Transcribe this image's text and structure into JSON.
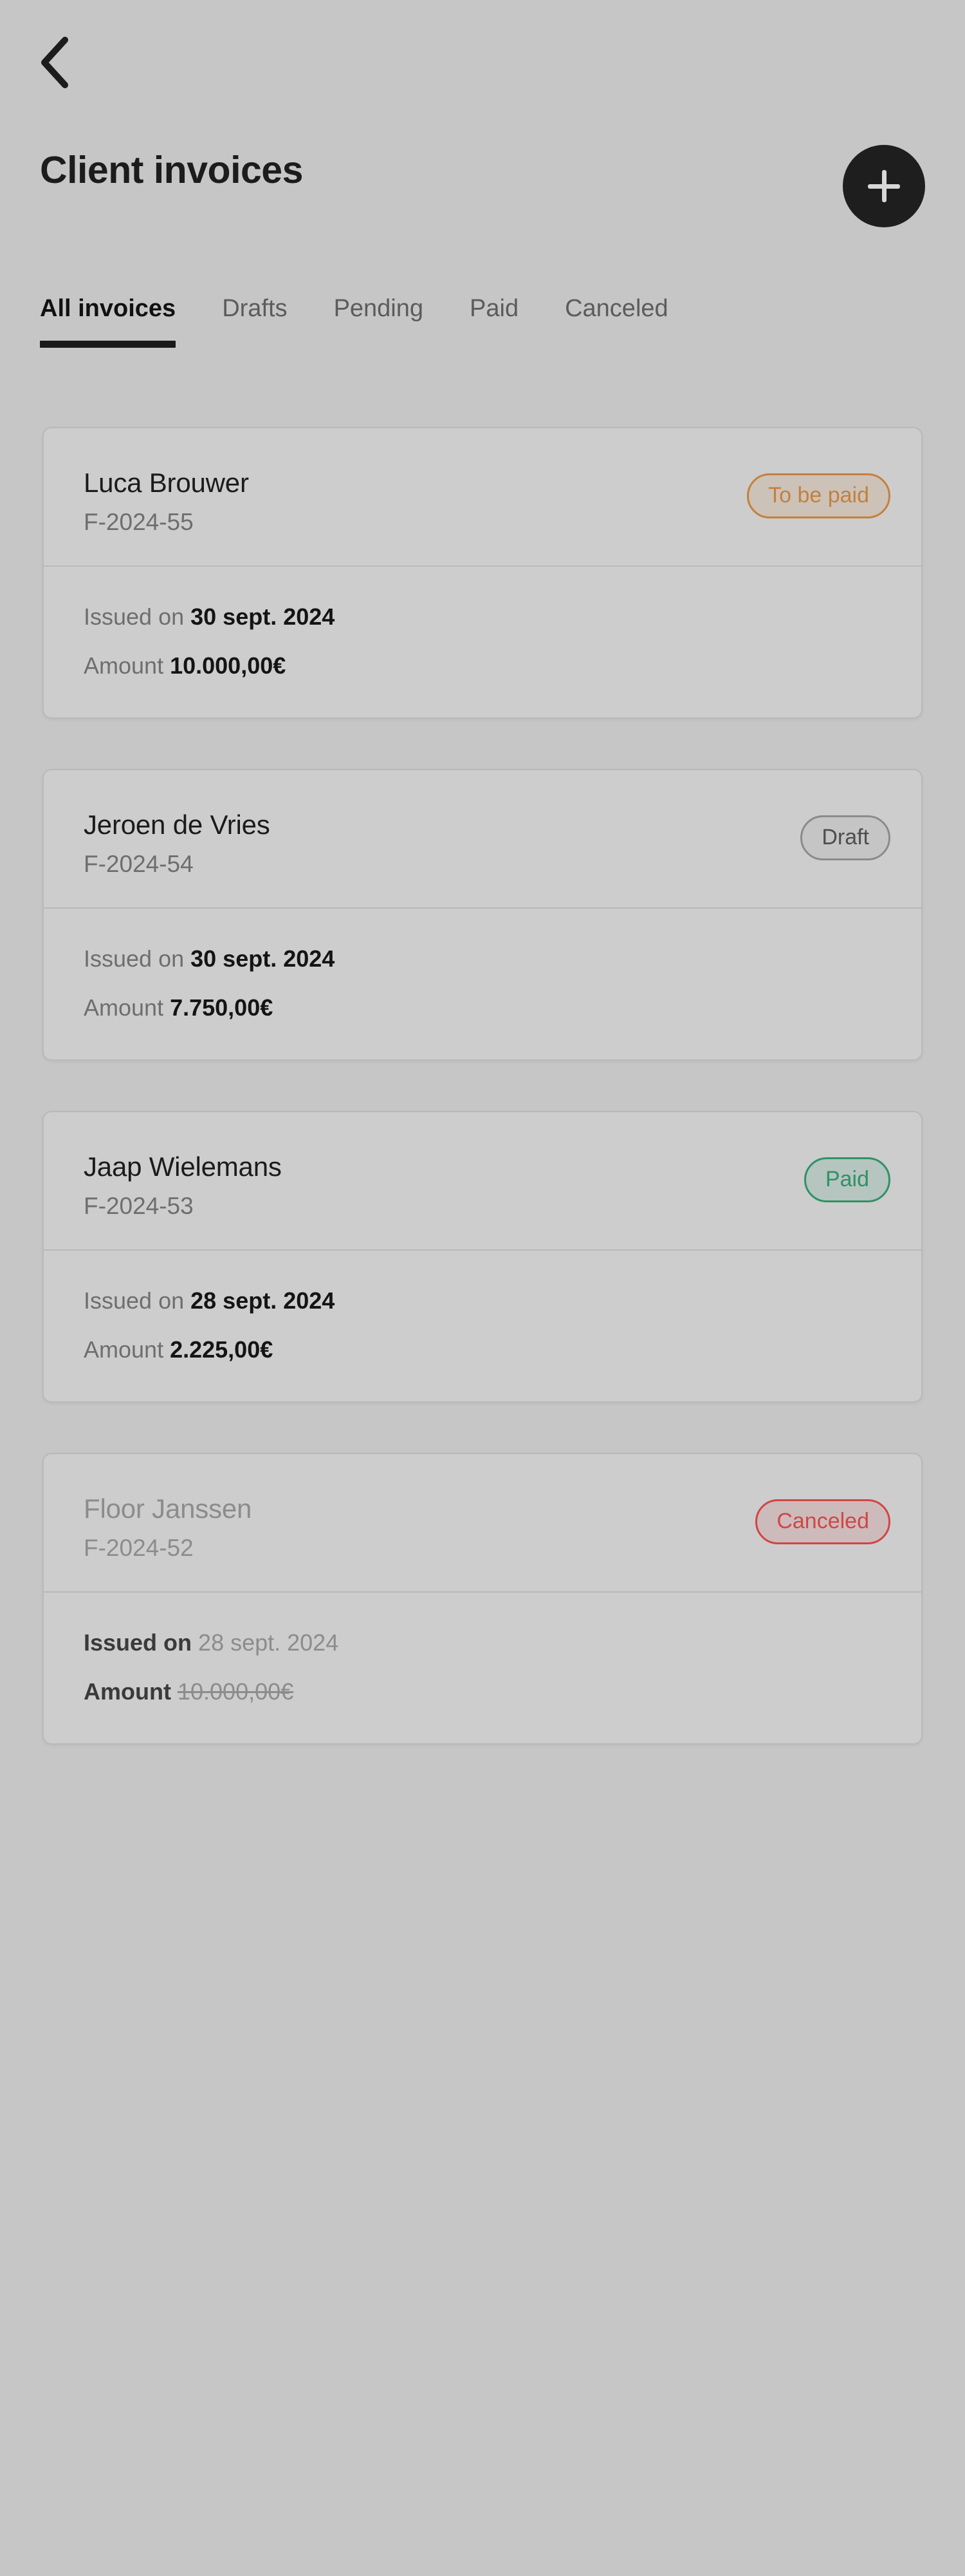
{
  "header": {
    "back_icon": "chevron-left-icon",
    "title": "Client invoices",
    "add_icon": "plus-icon",
    "add_label": "Add invoice"
  },
  "tabs": [
    {
      "label": "All invoices",
      "active": true
    },
    {
      "label": "Drafts",
      "active": false
    },
    {
      "label": "Pending",
      "active": false
    },
    {
      "label": "Paid",
      "active": false
    },
    {
      "label": "Canceled",
      "active": false
    }
  ],
  "labels": {
    "issued_on": "Issued on",
    "amount": "Amount"
  },
  "colors": {
    "page_background": "#c6c6c6",
    "card_background": "#cdcdcd",
    "card_border": "#b9b9b9",
    "text_primary": "#1b1b1b",
    "text_secondary": "#6e6e6e",
    "accent_dark": "#1e1e1e",
    "status_to_be_paid": "#c5803c",
    "status_draft": "#4e4e4e",
    "status_paid": "#2e9268",
    "status_canceled": "#d24545"
  },
  "invoices": [
    {
      "client": "Luca Brouwer",
      "number": "F-2024-55",
      "status": "To be paid",
      "status_key": "tobepaid",
      "issued_on": "30 sept. 2024",
      "amount": "10.000,00€",
      "muted": false,
      "amount_struck": false
    },
    {
      "client": "Jeroen de Vries",
      "number": "F-2024-54",
      "status": "Draft",
      "status_key": "draft",
      "issued_on": "30 sept. 2024",
      "amount": "7.750,00€",
      "muted": false,
      "amount_struck": false
    },
    {
      "client": "Jaap Wielemans",
      "number": "F-2024-53",
      "status": "Paid",
      "status_key": "paid",
      "issued_on": "28 sept. 2024",
      "amount": "2.225,00€",
      "muted": false,
      "amount_struck": false
    },
    {
      "client": "Floor Janssen",
      "number": "F-2024-52",
      "status": "Canceled",
      "status_key": "canceled",
      "issued_on": "28 sept. 2024",
      "amount": "10.000,00€",
      "muted": true,
      "amount_struck": true
    }
  ]
}
